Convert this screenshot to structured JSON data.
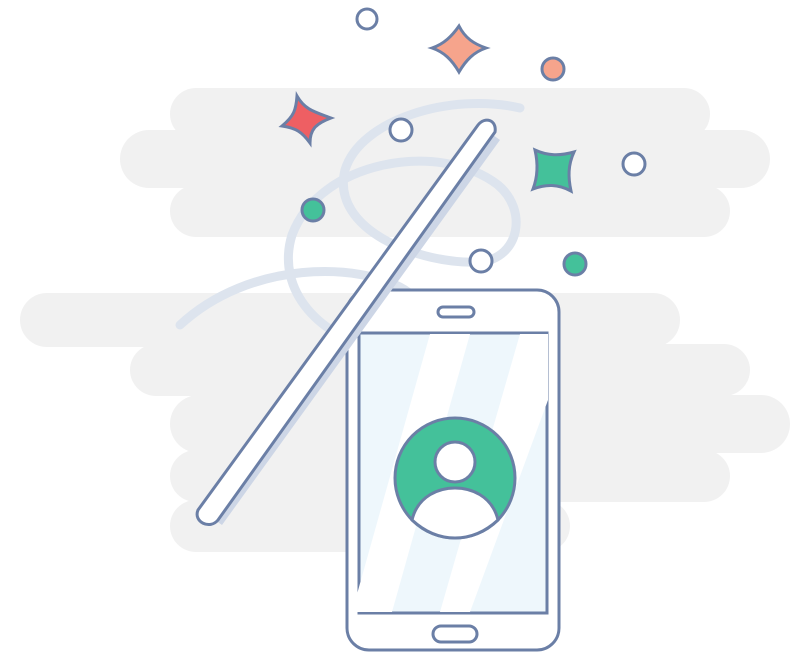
{
  "illustration": {
    "subject": "magic-wand-over-smartphone-with-user-avatar",
    "icons": [
      "cloud-background-icon",
      "magic-wand-icon",
      "smartphone-icon",
      "user-avatar-icon",
      "sparkle-star-icon",
      "bubble-icon"
    ]
  },
  "colors": {
    "cloud": "#f1f1f1",
    "outline": "#6b7fa6",
    "wand_fill": "#ffffff",
    "wand_shadow": "#cdd6e6",
    "swirl": "#dde4ee",
    "screen": "#eef7fc",
    "screen_glare": "#ffffff",
    "avatar": "#44c19a",
    "star_red": "#ee5f63",
    "star_peach": "#f6a48c",
    "star_green": "#44c19a",
    "bubble_fill": "#ffffff"
  }
}
